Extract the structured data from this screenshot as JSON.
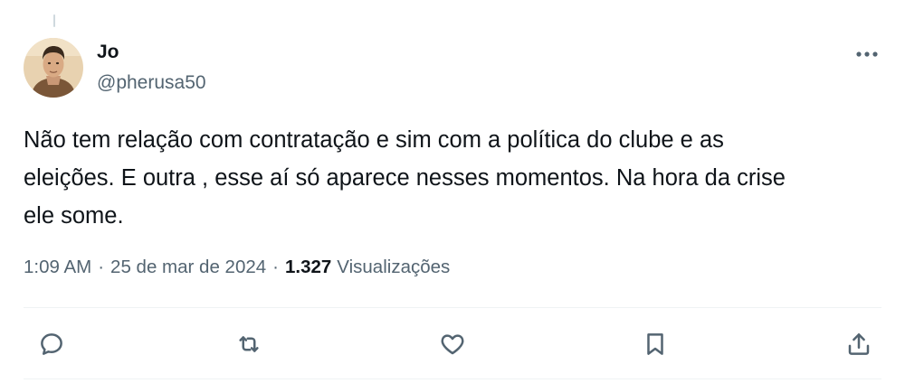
{
  "tweet": {
    "author": {
      "display_name": "Jo",
      "handle": "@pherusa50",
      "avatar_icon": "profile-photo"
    },
    "text": "Não tem relação com contratação e sim com a política do clube e as\neleições. E outra , esse aí só aparece nesses momentos. Na hora da crise\nele some.",
    "time": "1:09 AM",
    "separator": "·",
    "date": "25 de mar de 2024",
    "views_count": "1.327",
    "views_label": "Visualizações"
  },
  "actions": [
    {
      "name": "reply",
      "icon": "reply-icon"
    },
    {
      "name": "retweet",
      "icon": "retweet-icon"
    },
    {
      "name": "like",
      "icon": "heart-icon"
    },
    {
      "name": "bookmark",
      "icon": "bookmark-icon"
    },
    {
      "name": "share",
      "icon": "share-icon"
    }
  ],
  "colors": {
    "primary_text": "#0f1419",
    "secondary_text": "#536471",
    "divider": "#eff3f4",
    "thread_line": "#cfd9de"
  }
}
